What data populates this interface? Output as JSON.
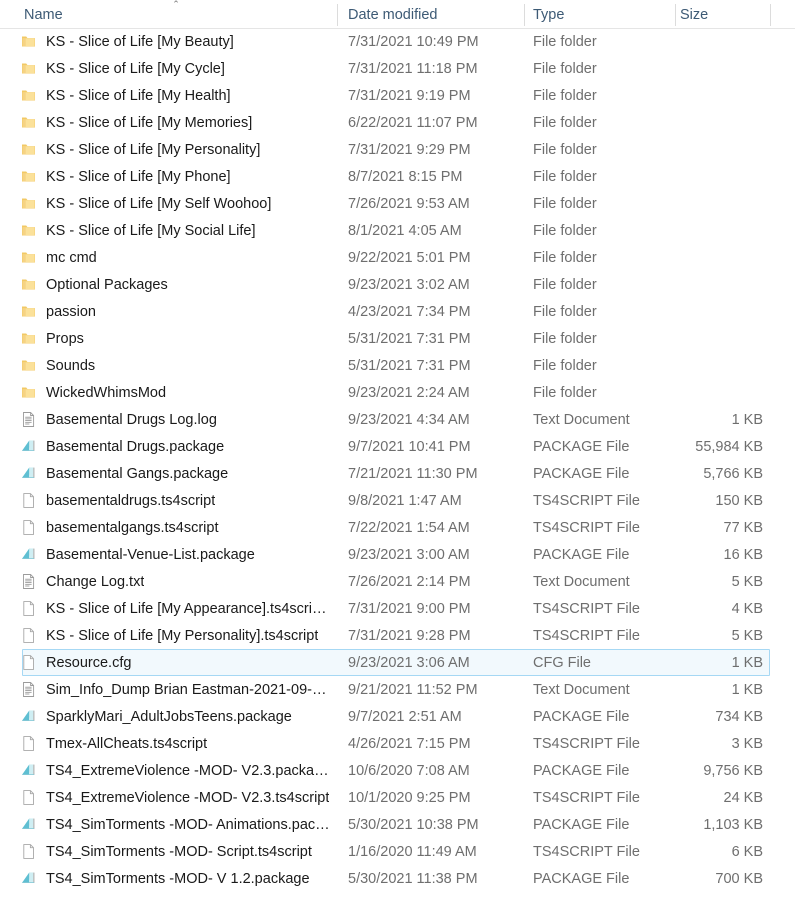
{
  "header": {
    "sort_indicator": "⌃",
    "columns": [
      {
        "label": "Name",
        "key": "name"
      },
      {
        "label": "Date modified",
        "key": "date"
      },
      {
        "label": "Type",
        "key": "type"
      },
      {
        "label": "Size",
        "key": "size"
      }
    ]
  },
  "colors": {
    "selection_fill": "#f2f9fd",
    "selection_border": "#a6d8f4",
    "header_text": "#3d5a75",
    "name_text": "#1a1a1a",
    "meta_text": "#6e6e6e",
    "folder_icon": "#f7d98a",
    "package_icon": "#7fd0dc"
  },
  "rows": [
    {
      "name": "KS - Slice of Life [My Beauty]",
      "date": "7/31/2021 10:49 PM",
      "type": "File folder",
      "size": "",
      "icon": "folder-icon",
      "selected": false
    },
    {
      "name": "KS - Slice of Life [My Cycle]",
      "date": "7/31/2021 11:18 PM",
      "type": "File folder",
      "size": "",
      "icon": "folder-icon",
      "selected": false
    },
    {
      "name": "KS - Slice of Life [My Health]",
      "date": "7/31/2021 9:19 PM",
      "type": "File folder",
      "size": "",
      "icon": "folder-icon",
      "selected": false
    },
    {
      "name": "KS - Slice of Life [My Memories]",
      "date": "6/22/2021 11:07 PM",
      "type": "File folder",
      "size": "",
      "icon": "folder-icon",
      "selected": false
    },
    {
      "name": "KS - Slice of Life [My Personality]",
      "date": "7/31/2021 9:29 PM",
      "type": "File folder",
      "size": "",
      "icon": "folder-icon",
      "selected": false
    },
    {
      "name": "KS - Slice of Life [My Phone]",
      "date": "8/7/2021 8:15 PM",
      "type": "File folder",
      "size": "",
      "icon": "folder-icon",
      "selected": false
    },
    {
      "name": "KS - Slice of Life [My Self Woohoo]",
      "date": "7/26/2021 9:53 AM",
      "type": "File folder",
      "size": "",
      "icon": "folder-icon",
      "selected": false
    },
    {
      "name": "KS - Slice of Life [My Social Life]",
      "date": "8/1/2021 4:05 AM",
      "type": "File folder",
      "size": "",
      "icon": "folder-icon",
      "selected": false
    },
    {
      "name": "mc cmd",
      "date": "9/22/2021 5:01 PM",
      "type": "File folder",
      "size": "",
      "icon": "folder-icon",
      "selected": false
    },
    {
      "name": "Optional Packages",
      "date": "9/23/2021 3:02 AM",
      "type": "File folder",
      "size": "",
      "icon": "folder-icon",
      "selected": false
    },
    {
      "name": "passion",
      "date": "4/23/2021 7:34 PM",
      "type": "File folder",
      "size": "",
      "icon": "folder-icon",
      "selected": false
    },
    {
      "name": "Props",
      "date": "5/31/2021 7:31 PM",
      "type": "File folder",
      "size": "",
      "icon": "folder-icon",
      "selected": false
    },
    {
      "name": "Sounds",
      "date": "5/31/2021 7:31 PM",
      "type": "File folder",
      "size": "",
      "icon": "folder-icon",
      "selected": false
    },
    {
      "name": "WickedWhimsMod",
      "date": "9/23/2021 2:24 AM",
      "type": "File folder",
      "size": "",
      "icon": "folder-icon",
      "selected": false
    },
    {
      "name": "Basemental Drugs Log.log",
      "date": "9/23/2021 4:34 AM",
      "type": "Text Document",
      "size": "1 KB",
      "icon": "text-document-icon",
      "selected": false
    },
    {
      "name": "Basemental Drugs.package",
      "date": "9/7/2021 10:41 PM",
      "type": "PACKAGE File",
      "size": "55,984 KB",
      "icon": "package-icon",
      "selected": false
    },
    {
      "name": "Basemental Gangs.package",
      "date": "7/21/2021 11:30 PM",
      "type": "PACKAGE File",
      "size": "5,766 KB",
      "icon": "package-icon",
      "selected": false
    },
    {
      "name": "basementaldrugs.ts4script",
      "date": "9/8/2021 1:47 AM",
      "type": "TS4SCRIPT File",
      "size": "150 KB",
      "icon": "blank-page-icon",
      "selected": false
    },
    {
      "name": "basementalgangs.ts4script",
      "date": "7/22/2021 1:54 AM",
      "type": "TS4SCRIPT File",
      "size": "77 KB",
      "icon": "blank-page-icon",
      "selected": false
    },
    {
      "name": "Basemental-Venue-List.package",
      "date": "9/23/2021 3:00 AM",
      "type": "PACKAGE File",
      "size": "16 KB",
      "icon": "package-icon",
      "selected": false
    },
    {
      "name": "Change Log.txt",
      "date": "7/26/2021 2:14 PM",
      "type": "Text Document",
      "size": "5 KB",
      "icon": "text-document-icon",
      "selected": false
    },
    {
      "name": "KS - Slice of Life [My Appearance].ts4scri…",
      "date": "7/31/2021 9:00 PM",
      "type": "TS4SCRIPT File",
      "size": "4 KB",
      "icon": "blank-page-icon",
      "selected": false
    },
    {
      "name": "KS - Slice of Life [My Personality].ts4script",
      "date": "7/31/2021 9:28 PM",
      "type": "TS4SCRIPT File",
      "size": "5 KB",
      "icon": "blank-page-icon",
      "selected": false
    },
    {
      "name": "Resource.cfg",
      "date": "9/23/2021 3:06 AM",
      "type": "CFG File",
      "size": "1 KB",
      "icon": "blank-page-icon",
      "selected": true
    },
    {
      "name": "Sim_Info_Dump Brian Eastman-2021-09-…",
      "date": "9/21/2021 11:52 PM",
      "type": "Text Document",
      "size": "1 KB",
      "icon": "text-document-icon",
      "selected": false
    },
    {
      "name": "SparklyMari_AdultJobsTeens.package",
      "date": "9/7/2021 2:51 AM",
      "type": "PACKAGE File",
      "size": "734 KB",
      "icon": "package-icon",
      "selected": false
    },
    {
      "name": "Tmex-AllCheats.ts4script",
      "date": "4/26/2021 7:15 PM",
      "type": "TS4SCRIPT File",
      "size": "3 KB",
      "icon": "blank-page-icon",
      "selected": false
    },
    {
      "name": "TS4_ExtremeViolence -MOD- V2.3.packa…",
      "date": "10/6/2020 7:08 AM",
      "type": "PACKAGE File",
      "size": "9,756 KB",
      "icon": "package-icon",
      "selected": false
    },
    {
      "name": "TS4_ExtremeViolence -MOD- V2.3.ts4script",
      "date": "10/1/2020 9:25 PM",
      "type": "TS4SCRIPT File",
      "size": "24 KB",
      "icon": "blank-page-icon",
      "selected": false
    },
    {
      "name": "TS4_SimTorments -MOD- Animations.pac…",
      "date": "5/30/2021 10:38 PM",
      "type": "PACKAGE File",
      "size": "1,103 KB",
      "icon": "package-icon",
      "selected": false
    },
    {
      "name": "TS4_SimTorments -MOD- Script.ts4script",
      "date": "1/16/2020 11:49 AM",
      "type": "TS4SCRIPT File",
      "size": "6 KB",
      "icon": "blank-page-icon",
      "selected": false
    },
    {
      "name": "TS4_SimTorments -MOD- V 1.2.package",
      "date": "5/30/2021 11:38 PM",
      "type": "PACKAGE File",
      "size": "700 KB",
      "icon": "package-icon",
      "selected": false
    }
  ]
}
